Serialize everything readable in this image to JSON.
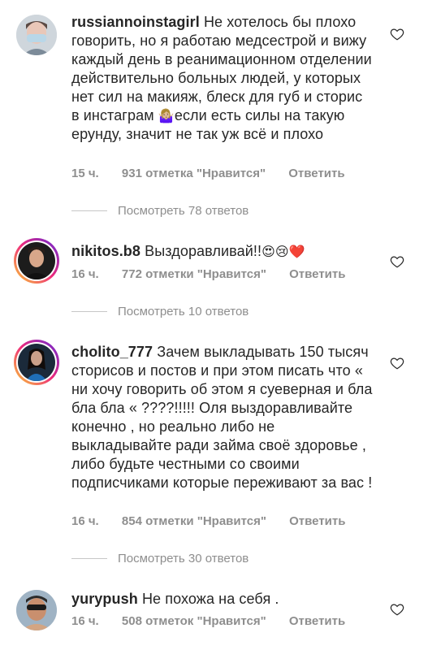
{
  "comments": [
    {
      "username": "russiannoinstagirl",
      "text": "Не хотелось бы плохо говорить, но я работаю медсестрой и вижу каждый день в реанимационном отделении действительно больных людей, у которых нет сил на макияж, блеск для губ и сторис в инстаграм",
      "emoji": "🤷🏼‍♀️",
      "text_after": "если есть силы на такую ерунду, значит не так уж всё и плохо",
      "time": "15 ч.",
      "likes": "931 отметка \"Нравится\"",
      "reply": "Ответить",
      "view_replies": "Посмотреть 78 ответов"
    },
    {
      "username": "nikitos.b8",
      "text": "Выздоравливай!!",
      "emoji": "😍😢❤️",
      "time": "16 ч.",
      "likes": "772 отметки \"Нравится\"",
      "reply": "Ответить",
      "view_replies": "Посмотреть 10 ответов"
    },
    {
      "username": "cholito_777",
      "text": "Зачем выкладывать 150 тысяч сторисов и постов и при этом писать что « ни хочу говорить об этом я суеверная и бла бла бла « ????!!!!! Оля выздоравливайте конечно , но реально либо не выкладывайте ради займа своё здоровье , либо будьте честными со своими подписчиками которые переживают за вас !",
      "time": "16 ч.",
      "likes": "854 отметки \"Нравится\"",
      "reply": "Ответить",
      "view_replies": "Посмотреть 30 ответов"
    },
    {
      "username": "yurypush",
      "text": "Не похожа на себя .",
      "time": "16 ч.",
      "likes": "508 отметок \"Нравится\"",
      "reply": "Ответить"
    }
  ],
  "icons": {
    "like": "heart-outline-icon"
  }
}
